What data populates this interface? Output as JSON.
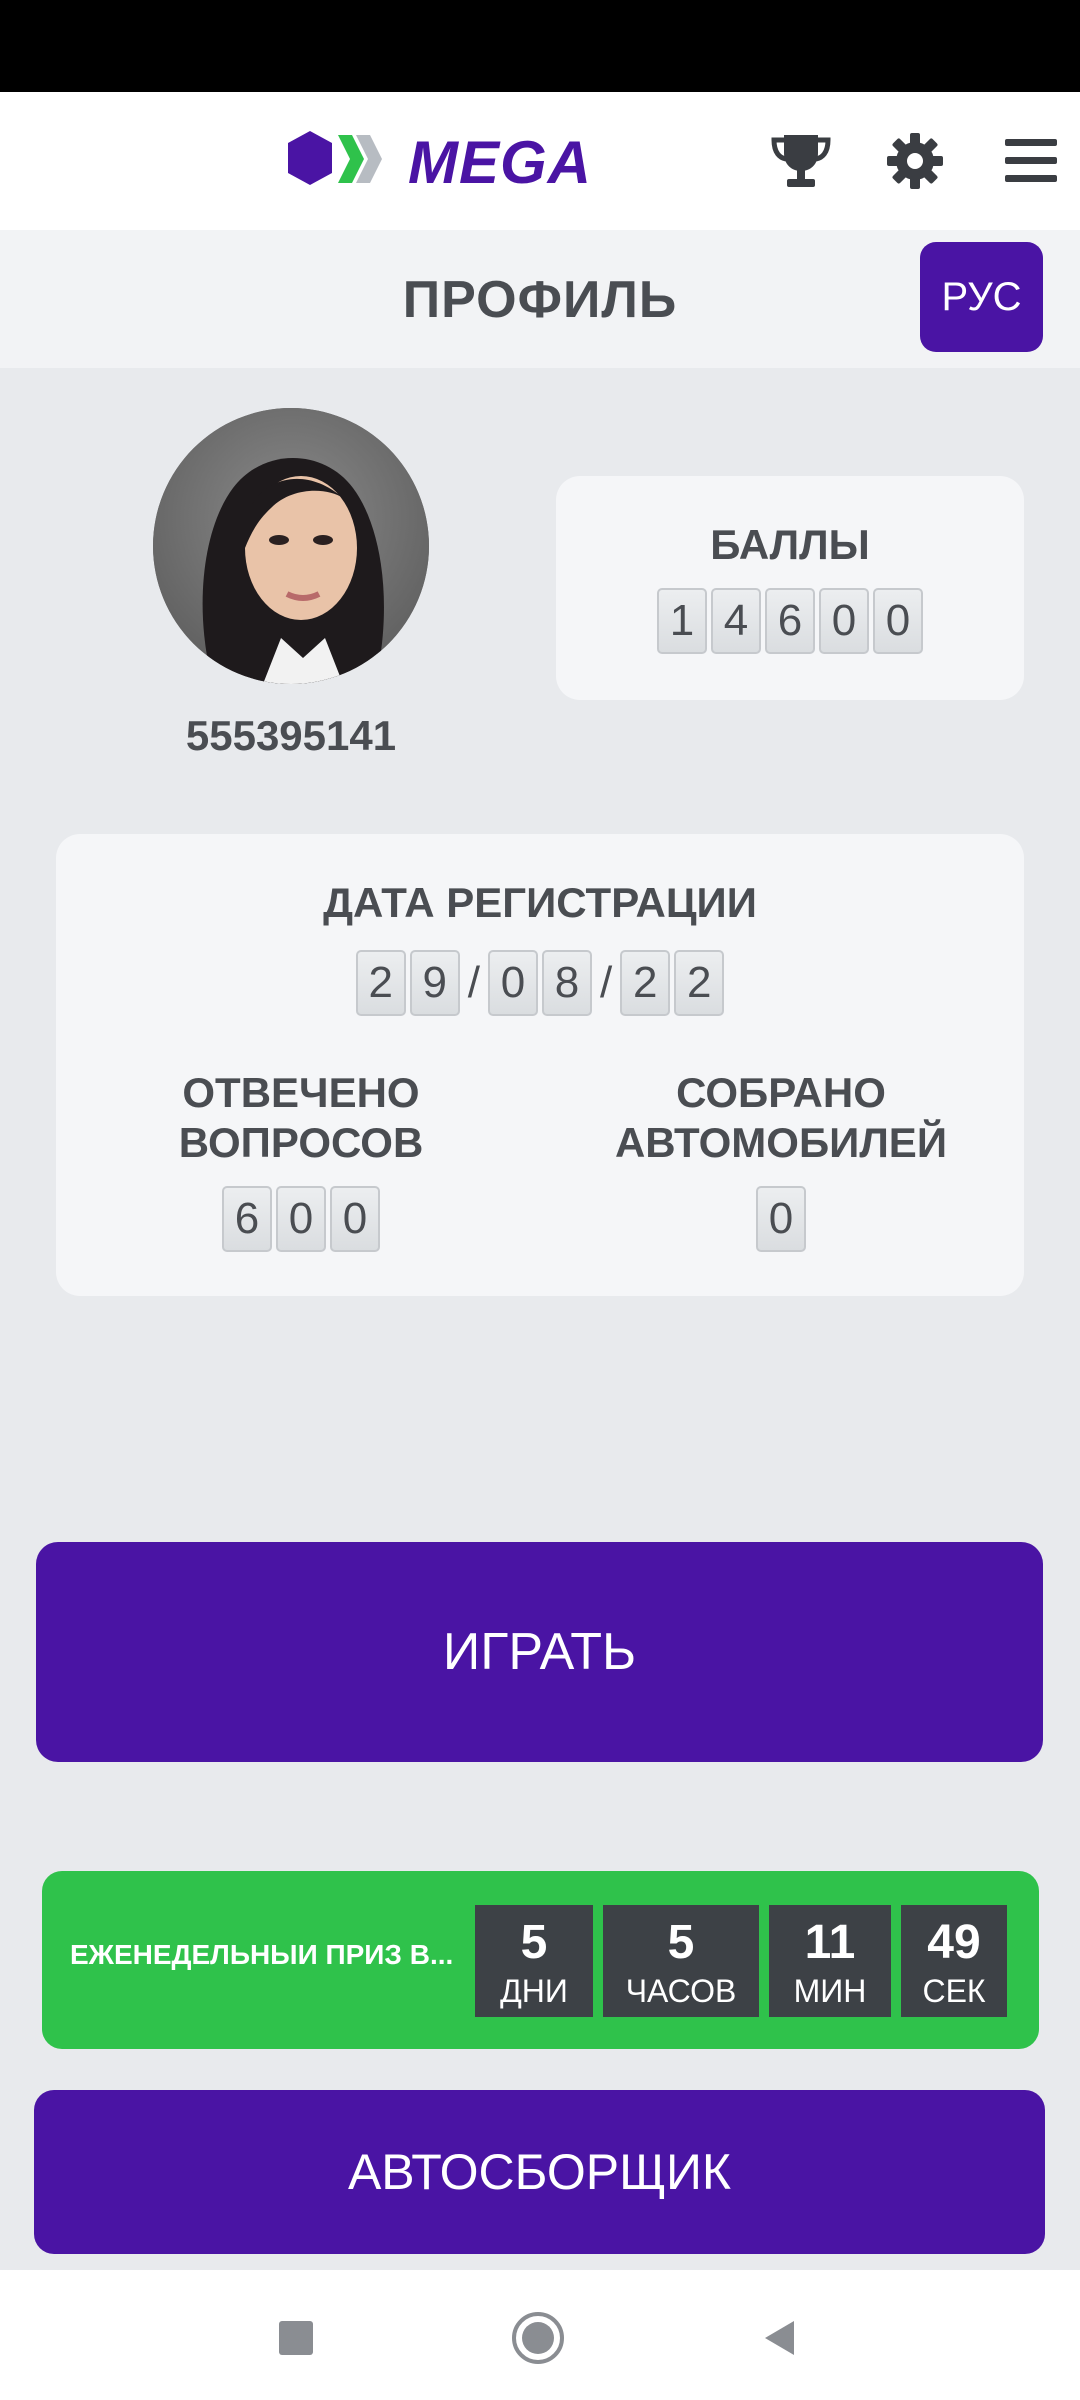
{
  "app": {
    "logo_text": "MEGA",
    "brand_color": "#4a14a4",
    "accent_green": "#2fc24b"
  },
  "header": {
    "icons": [
      "trophy-icon",
      "gear-icon",
      "menu-icon"
    ]
  },
  "page": {
    "title": "ПРОФИЛЬ",
    "lang_label": "РУС"
  },
  "profile": {
    "user_id": "555395141",
    "points_label": "БАЛЛЫ",
    "points_digits": [
      "1",
      "4",
      "6",
      "0",
      "0"
    ],
    "reg_label": "ДАТА РЕГИСТРАЦИИ",
    "reg_day": [
      "2",
      "9"
    ],
    "reg_month": [
      "0",
      "8"
    ],
    "reg_year": [
      "2",
      "2"
    ],
    "date_sep": "/",
    "answered_label_1": "ОТВЕЧЕНО",
    "answered_label_2": "ВОПРОСОВ",
    "answered_digits": [
      "6",
      "0",
      "0"
    ],
    "cars_label_1": "СОБРАНО",
    "cars_label_2": "АВТОМОБИЛЕЙ",
    "cars_digits": [
      "0"
    ]
  },
  "actions": {
    "play_label": "ИГРАТЬ",
    "auto_label": "АВТОСБОРЩИК"
  },
  "prize": {
    "label": "ЕЖЕНЕДЕЛЬНЫИ ПРИЗ В...",
    "days": "5",
    "days_unit": "ДНИ",
    "hours": "5",
    "hours_unit": "ЧАСОВ",
    "minutes": "11",
    "minutes_unit": "МИН",
    "seconds": "49",
    "seconds_unit": "СЕК"
  },
  "navigation": {
    "buttons": [
      "recent-apps-icon",
      "home-icon",
      "back-icon"
    ]
  }
}
